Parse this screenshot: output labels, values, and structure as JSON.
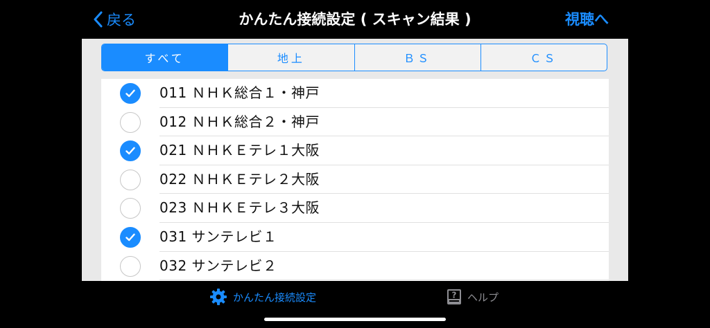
{
  "nav": {
    "back_label": "戻る",
    "title": "かんたん接続設定 ( スキャン結果 )",
    "watch_label": "視聴へ"
  },
  "segments": [
    {
      "label": "すべて",
      "active": true
    },
    {
      "label": "地上",
      "active": false
    },
    {
      "label": "ＢＳ",
      "active": false
    },
    {
      "label": "ＣＳ",
      "active": false
    }
  ],
  "channels": [
    {
      "label": "011 ＮＨＫ総合１・神戸",
      "checked": true
    },
    {
      "label": "012 ＮＨＫ総合２・神戸",
      "checked": false
    },
    {
      "label": "021 ＮＨＫＥテレ１大阪",
      "checked": true
    },
    {
      "label": "022 ＮＨＫＥテレ２大阪",
      "checked": false
    },
    {
      "label": "023 ＮＨＫＥテレ３大阪",
      "checked": false
    },
    {
      "label": "031 サンテレビ１",
      "checked": true
    },
    {
      "label": "032 サンテレビ２",
      "checked": false
    }
  ],
  "tabbar": {
    "easy_setup": {
      "label": "かんたん接続設定",
      "icon": "gear-icon"
    },
    "help": {
      "label": "ヘルプ",
      "icon": "help-icon"
    }
  },
  "colors": {
    "accent": "#1a8cff",
    "background": "#000000",
    "panel": "#e9e9e9",
    "inactive_tab": "#8e8e93"
  }
}
